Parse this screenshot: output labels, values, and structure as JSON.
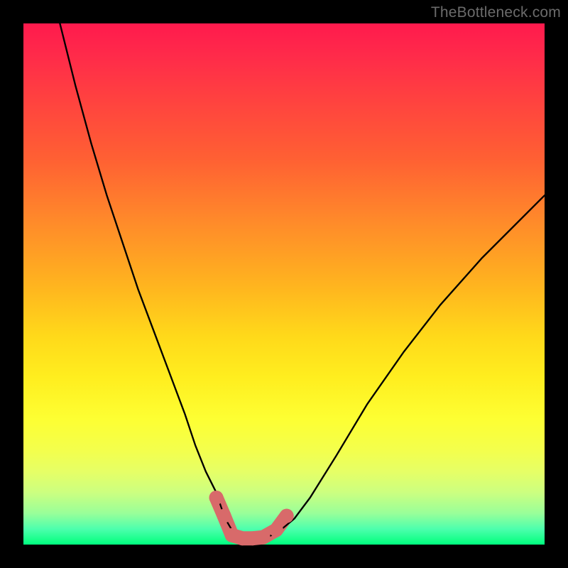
{
  "watermark": "TheBottleneck.com",
  "chart_data": {
    "type": "line",
    "title": "",
    "xlabel": "",
    "ylabel": "",
    "xlim": [
      0,
      100
    ],
    "ylim": [
      0,
      100
    ],
    "grid": false,
    "series": [
      {
        "name": "bottleneck-curve",
        "x": [
          7,
          10,
          13,
          16,
          19,
          22,
          25,
          28,
          31,
          33,
          35,
          37,
          38,
          39,
          40,
          41,
          42,
          44,
          45,
          47,
          49,
          52,
          55,
          60,
          66,
          73,
          80,
          88,
          96,
          100
        ],
        "values": [
          100,
          88,
          77,
          67,
          58,
          49,
          41,
          33,
          25,
          19,
          14,
          10,
          7,
          4.5,
          2.8,
          1.6,
          1.0,
          1.0,
          1.1,
          1.5,
          2.5,
          5,
          9,
          17,
          27,
          37,
          46,
          55,
          63,
          67
        ]
      }
    ],
    "markers": [
      {
        "name": "left-dot-upper",
        "x": 37,
        "y": 9.0
      },
      {
        "name": "left-dot-lower",
        "x": 38.5,
        "y": 5.5
      },
      {
        "name": "floor-dot-1",
        "x": 40,
        "y": 1.8
      },
      {
        "name": "floor-dot-2",
        "x": 42,
        "y": 1.2
      },
      {
        "name": "floor-dot-3",
        "x": 44,
        "y": 1.2
      },
      {
        "name": "floor-dot-4",
        "x": 46,
        "y": 1.4
      },
      {
        "name": "right-dot-lower",
        "x": 48.5,
        "y": 2.8
      },
      {
        "name": "right-dot-upper",
        "x": 50.5,
        "y": 5.5
      }
    ],
    "marker_style": {
      "color": "#d86a6a",
      "radius_px": 10
    }
  }
}
